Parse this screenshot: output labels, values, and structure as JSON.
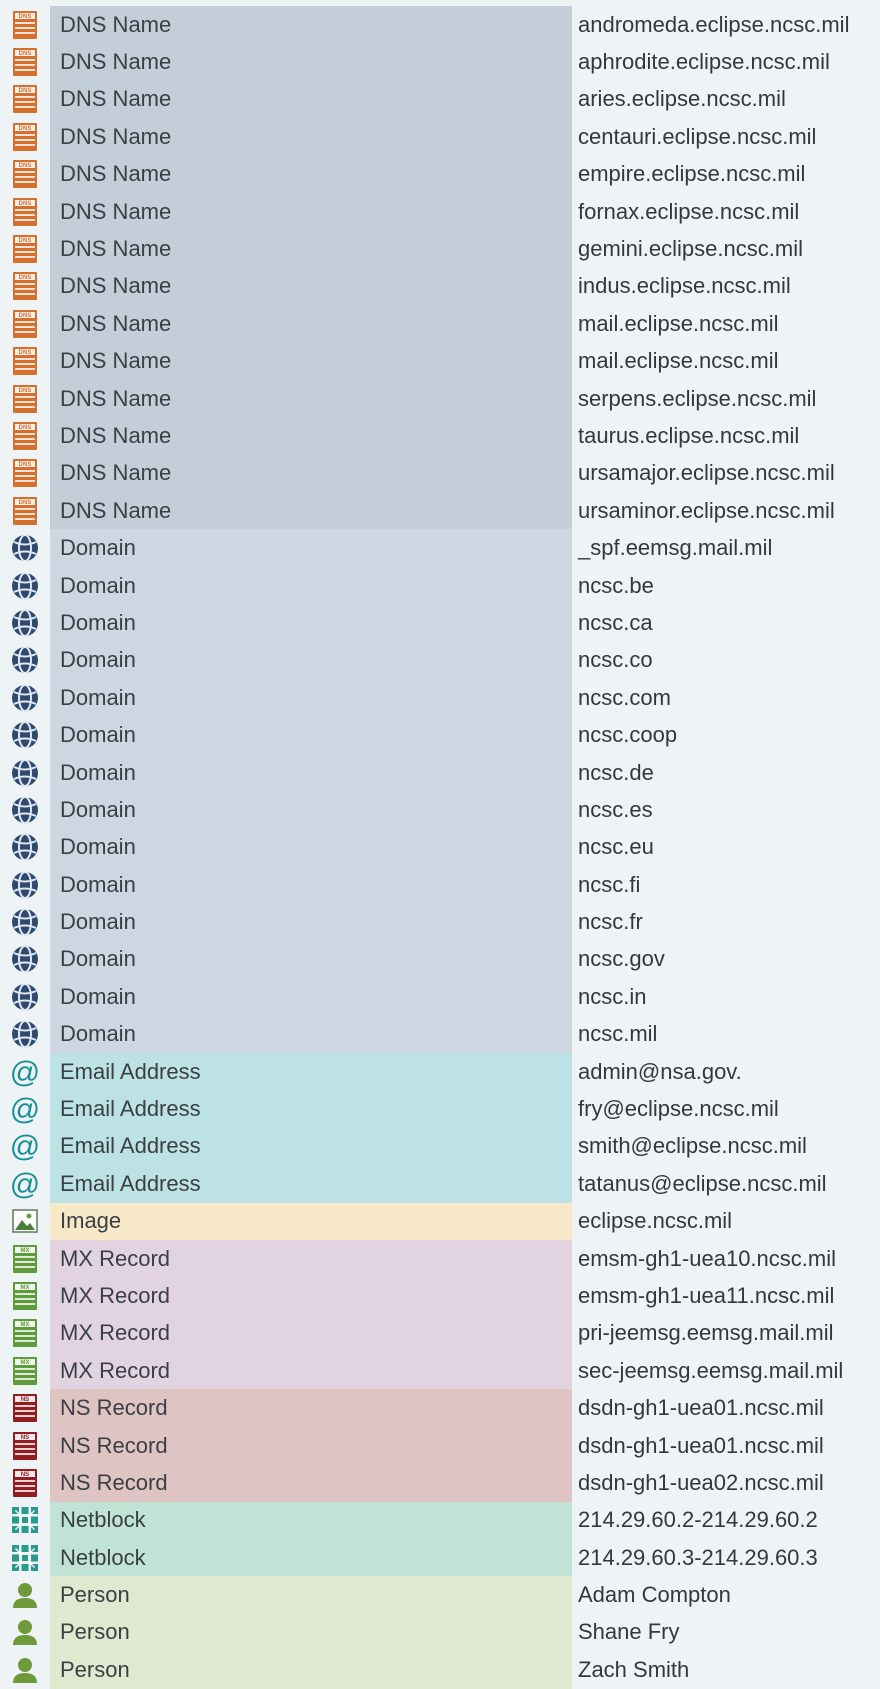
{
  "header": {
    "partial_text": ""
  },
  "colors": {
    "dns": "#c4ced8",
    "domain": "#cdd6e1",
    "email": "#bde2e5",
    "image": "#f7e9c8",
    "mx": "#e1d3e0",
    "ns": "#dfc4c4",
    "netblock": "#c0e3d6",
    "person": "#dfe9d0"
  },
  "rows": [
    {
      "kind": "dns",
      "icon": "dns-server-icon",
      "type": "DNS Name",
      "value": "andromeda.eclipse.ncsc.mil"
    },
    {
      "kind": "dns",
      "icon": "dns-server-icon",
      "type": "DNS Name",
      "value": "aphrodite.eclipse.ncsc.mil"
    },
    {
      "kind": "dns",
      "icon": "dns-server-icon",
      "type": "DNS Name",
      "value": "aries.eclipse.ncsc.mil"
    },
    {
      "kind": "dns",
      "icon": "dns-server-icon",
      "type": "DNS Name",
      "value": "centauri.eclipse.ncsc.mil"
    },
    {
      "kind": "dns",
      "icon": "dns-server-icon",
      "type": "DNS Name",
      "value": "empire.eclipse.ncsc.mil"
    },
    {
      "kind": "dns",
      "icon": "dns-server-icon",
      "type": "DNS Name",
      "value": "fornax.eclipse.ncsc.mil"
    },
    {
      "kind": "dns",
      "icon": "dns-server-icon",
      "type": "DNS Name",
      "value": "gemini.eclipse.ncsc.mil"
    },
    {
      "kind": "dns",
      "icon": "dns-server-icon",
      "type": "DNS Name",
      "value": "indus.eclipse.ncsc.mil"
    },
    {
      "kind": "dns",
      "icon": "dns-server-icon",
      "type": "DNS Name",
      "value": "mail.eclipse.ncsc.mil"
    },
    {
      "kind": "dns",
      "icon": "dns-server-icon",
      "type": "DNS Name",
      "value": "mail.eclipse.ncsc.mil"
    },
    {
      "kind": "dns",
      "icon": "dns-server-icon",
      "type": "DNS Name",
      "value": "serpens.eclipse.ncsc.mil"
    },
    {
      "kind": "dns",
      "icon": "dns-server-icon",
      "type": "DNS Name",
      "value": "taurus.eclipse.ncsc.mil"
    },
    {
      "kind": "dns",
      "icon": "dns-server-icon",
      "type": "DNS Name",
      "value": "ursamajor.eclipse.ncsc.mil"
    },
    {
      "kind": "dns",
      "icon": "dns-server-icon",
      "type": "DNS Name",
      "value": "ursaminor.eclipse.ncsc.mil"
    },
    {
      "kind": "domain",
      "icon": "globe-icon",
      "type": "Domain",
      "value": "_spf.eemsg.mail.mil"
    },
    {
      "kind": "domain",
      "icon": "globe-icon",
      "type": "Domain",
      "value": "ncsc.be"
    },
    {
      "kind": "domain",
      "icon": "globe-icon",
      "type": "Domain",
      "value": "ncsc.ca"
    },
    {
      "kind": "domain",
      "icon": "globe-icon",
      "type": "Domain",
      "value": "ncsc.co"
    },
    {
      "kind": "domain",
      "icon": "globe-icon",
      "type": "Domain",
      "value": "ncsc.com"
    },
    {
      "kind": "domain",
      "icon": "globe-icon",
      "type": "Domain",
      "value": "ncsc.coop"
    },
    {
      "kind": "domain",
      "icon": "globe-icon",
      "type": "Domain",
      "value": "ncsc.de"
    },
    {
      "kind": "domain",
      "icon": "globe-icon",
      "type": "Domain",
      "value": "ncsc.es"
    },
    {
      "kind": "domain",
      "icon": "globe-icon",
      "type": "Domain",
      "value": "ncsc.eu"
    },
    {
      "kind": "domain",
      "icon": "globe-icon",
      "type": "Domain",
      "value": "ncsc.fi"
    },
    {
      "kind": "domain",
      "icon": "globe-icon",
      "type": "Domain",
      "value": "ncsc.fr"
    },
    {
      "kind": "domain",
      "icon": "globe-icon",
      "type": "Domain",
      "value": "ncsc.gov"
    },
    {
      "kind": "domain",
      "icon": "globe-icon",
      "type": "Domain",
      "value": "ncsc.in"
    },
    {
      "kind": "domain",
      "icon": "globe-icon",
      "type": "Domain",
      "value": "ncsc.mil"
    },
    {
      "kind": "email",
      "icon": "at-sign-icon",
      "type": "Email Address",
      "value": "admin@nsa.gov."
    },
    {
      "kind": "email",
      "icon": "at-sign-icon",
      "type": "Email Address",
      "value": "fry@eclipse.ncsc.mil"
    },
    {
      "kind": "email",
      "icon": "at-sign-icon",
      "type": "Email Address",
      "value": "smith@eclipse.ncsc.mil"
    },
    {
      "kind": "email",
      "icon": "at-sign-icon",
      "type": "Email Address",
      "value": "tatanus@eclipse.ncsc.mil"
    },
    {
      "kind": "image",
      "icon": "image-icon",
      "type": "Image",
      "value": "eclipse.ncsc.mil"
    },
    {
      "kind": "mx",
      "icon": "mx-server-icon",
      "type": "MX Record",
      "value": "emsm-gh1-uea10.ncsc.mil"
    },
    {
      "kind": "mx",
      "icon": "mx-server-icon",
      "type": "MX Record",
      "value": "emsm-gh1-uea11.ncsc.mil"
    },
    {
      "kind": "mx",
      "icon": "mx-server-icon",
      "type": "MX Record",
      "value": "pri-jeemsg.eemsg.mail.mil"
    },
    {
      "kind": "mx",
      "icon": "mx-server-icon",
      "type": "MX Record",
      "value": "sec-jeemsg.eemsg.mail.mil"
    },
    {
      "kind": "ns",
      "icon": "ns-server-icon",
      "type": "NS Record",
      "value": "dsdn-gh1-uea01.ncsc.mil"
    },
    {
      "kind": "ns",
      "icon": "ns-server-icon",
      "type": "NS Record",
      "value": "dsdn-gh1-uea01.ncsc.mil"
    },
    {
      "kind": "ns",
      "icon": "ns-server-icon",
      "type": "NS Record",
      "value": "dsdn-gh1-uea02.ncsc.mil"
    },
    {
      "kind": "netblock",
      "icon": "netblock-icon",
      "type": "Netblock",
      "value": "214.29.60.2-214.29.60.2"
    },
    {
      "kind": "netblock",
      "icon": "netblock-icon",
      "type": "Netblock",
      "value": "214.29.60.3-214.29.60.3"
    },
    {
      "kind": "person",
      "icon": "person-icon",
      "type": "Person",
      "value": "Adam Compton"
    },
    {
      "kind": "person",
      "icon": "person-icon",
      "type": "Person",
      "value": "Shane Fry"
    },
    {
      "kind": "person",
      "icon": "person-icon",
      "type": "Person",
      "value": "Zach Smith"
    }
  ]
}
